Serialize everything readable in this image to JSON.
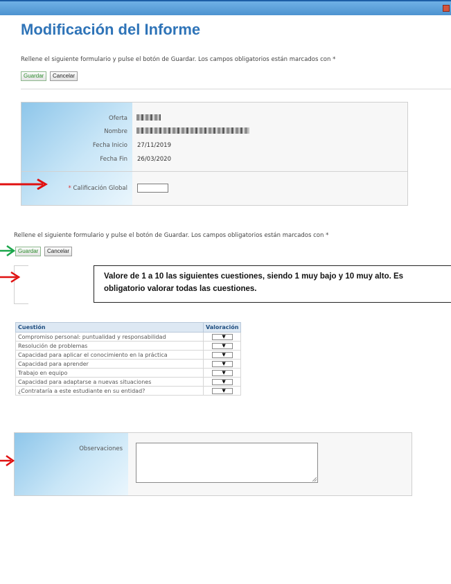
{
  "page": {
    "title": "Modificación del Informe"
  },
  "top_form": {
    "instructions": "Rellene el siguiente formulario y pulse el botón de Guardar. Los campos obligatorios están marcados con *",
    "save_label": "Guardar",
    "cancel_label": "Cancelar"
  },
  "details": {
    "oferta_label": "Oferta",
    "nombre_label": "Nombre",
    "fecha_inicio_label": "Fecha Inicio",
    "fecha_inicio_value": "27/11/2019",
    "fecha_fin_label": "Fecha Fin",
    "fecha_fin_value": "26/03/2020",
    "calificacion_required_mark": "*",
    "calificacion_label": "Calificación Global",
    "calificacion_value": ""
  },
  "bottom_form": {
    "instructions": "Rellene el siguiente formulario y pulse el botón de Guardar. Los campos obligatorios están marcados con *",
    "save_label": "Guardar",
    "cancel_label": "Cancelar"
  },
  "note": "Valore de 1 a 10 las siguientes cuestiones, siendo 1 muy bajo y 10 muy alto. Es obligatorio valorar todas las cuestiones.",
  "questions": {
    "header_question": "Cuestión",
    "header_rating": "Valoración",
    "dropdown_glyph": "▼",
    "items": [
      "Compromiso personal: puntualidad y responsabilidad",
      "Resolución de problemas",
      "Capacidad para aplicar el conocimiento en la práctica",
      "Capacidad para aprender",
      "Trabajo en equipo",
      "Capacidad para adaptarse a nuevas situaciones",
      "¿Contrataría a este estudiante en su entidad?"
    ]
  },
  "observaciones": {
    "label": "Observaciones",
    "value": ""
  },
  "annotation_colors": {
    "red": "#e01010",
    "green": "#1aa64a"
  }
}
